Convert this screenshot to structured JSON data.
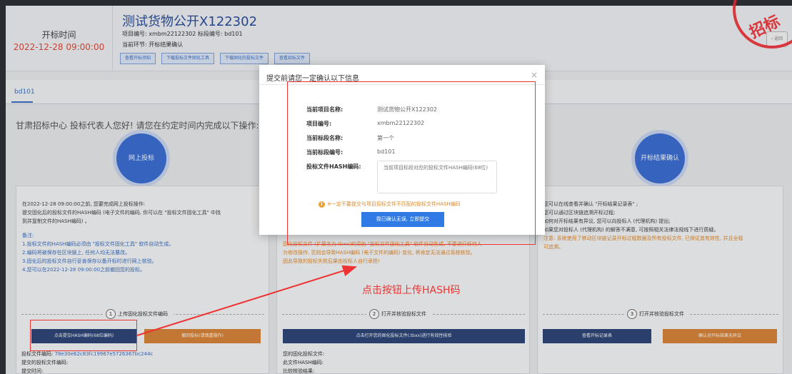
{
  "header": {
    "open_time_label": "开标时间",
    "open_time_value": "2022-12-28 09:00:00",
    "project_title": "测试货物公开X122302",
    "project_meta": "项目编号: xmbm22122302   标段编号: bd101",
    "current_stage": "当前环节: 开标结果确认",
    "buttons": [
      "查看开标须知",
      "下载投标文件固化工具",
      "下载固化的投标文件",
      "查看招标文件"
    ],
    "right_button": "‹ 返回"
  },
  "tabs": {
    "active": "bd101"
  },
  "greeting": "甘肃招标中心 投标代表人您好! 请您在约定时间内完成以下操作:",
  "steps": {
    "circle1": "网上投标",
    "circle3": "开标结果确认",
    "step1_num": "1",
    "step1_label": "上传固化投标文件编码",
    "step2_num": "2",
    "step2_label": "打开并核验投标文件",
    "step3_num": "3",
    "step3_label": "打开并核验投标文件"
  },
  "panel1": {
    "line1": "在2022-12-28 09:00:00之前, 您要完成网上投标操作:",
    "line2": "提交固化后的投标文件的HASH编码 (电子文件的编码, 你可以在 \"投标文件固化工具\" 中找",
    "line3": "到并复制文件的HASH编码) 。",
    "note_title": "备注:",
    "note1": "1.投标文件的HASH编码必须由 \"投标文件固化工具\" 软件自动生成。",
    "note2": "2.编码将被保存在区块链上, 任何人均无法篡改。",
    "note3": "3.固化后的投标文件自行妥善保存以备开标时进行网上核验。",
    "note4": "4.您可以在2022-12-28 09:00:00之前撤回您的投标。",
    "btn_submit_hash": "点击提交HASH编码(68位编码)",
    "btn_withdraw": "撤回投标(请慎重操作)",
    "bid_hash_label": "投标文件编码: ",
    "bid_hash_value": "78e30e62c83fc19967e5726367bc244c",
    "submitted_hash": "提交的投标文件编码:",
    "submit_time": "提交时间:"
  },
  "panel2": {
    "line1": "固化投标文件 (扩展名为.tbxx)的须由 \"投标文件固化工具\" 软件自动生成, 不要进行任何人",
    "line2": "为修改操作, 否则会导致HASH编码 (电子文件的编码) 变化, 将肯定无法通过系统核验。",
    "line3": "固此导致的投标失败后果由投标人自行承担!",
    "btn_open": "点击打开您的固化投标文件(.tbxx)进行有效性核验",
    "your_file": "您的固化投标文件:",
    "file_hash": "此文件HASH编码:",
    "verify": "比较核验结果:"
  },
  "panel3": {
    "line1": "您可以在线查看并确认 \"开标结果记录表\" ;",
    "line2": "您可以通过区块链追溯开标过程;",
    "line3": "如何对开标结果有异议, 您可以向投标人 (代理机构) 提出;",
    "line4": "如果您对投标人 (代理机构) 的解答不满意, 可按照相关法律法规线下进行质疑。",
    "line5": "注意: 系统使用了移动区块链记录开标过程数据及所有投标文件, 已保证其有效性, 并且全程",
    "line6": "可追溯。",
    "btn_view": "查看开标记录表",
    "btn_confirm": "确认对开标结果无异议"
  },
  "modal": {
    "title": "提交前请您一定确认以下信息",
    "close": "×",
    "project_name_label": "当前项目名称:",
    "project_name_value": "测试货物公开X122302",
    "project_no_label": "项目编号:",
    "project_no_value": "xmbm22122302",
    "section_name_label": "当前标段名称:",
    "section_name_value": "第一个",
    "section_no_label": "当前标段编号:",
    "section_no_value": "bd101",
    "hash_label": "投标文件HASH编码:",
    "hash_placeholder": "当前项目标段对应的投标文件HASH编码(68位)",
    "warning_icon": "!",
    "warning": "※一定不要提交与项目招标文件不匹配的投标文件HASH编码",
    "submit": "我已确认无误, 立即提交"
  },
  "annotation": "点击按钮上传HASH码",
  "colors": {
    "accent": "#3c6fd4",
    "navy": "#2f4778",
    "orange": "#d8863a",
    "annotation_red": "#ee3333"
  }
}
